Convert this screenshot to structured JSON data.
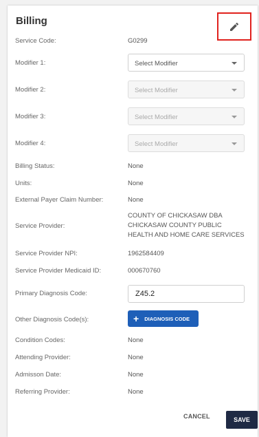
{
  "billing": {
    "title": "Billing",
    "service_code": {
      "label": "Service Code:",
      "value": "G0299"
    },
    "modifiers": [
      {
        "label": "Modifier 1:",
        "placeholder": "Select Modifier"
      },
      {
        "label": "Modifier 2:",
        "placeholder": "Select Modifier"
      },
      {
        "label": "Modifier 3:",
        "placeholder": "Select Modifier"
      },
      {
        "label": "Modifier 4:",
        "placeholder": "Select Modifier"
      }
    ],
    "billing_status": {
      "label": "Billing Status:",
      "value": "None"
    },
    "units": {
      "label": "Units:",
      "value": "None"
    },
    "external_payer_claim_number": {
      "label": "External Payer Claim Number:",
      "value": "None"
    },
    "service_provider": {
      "label": "Service Provider:",
      "lines": [
        "COUNTY OF CHICKASAW DBA",
        "CHICKASAW COUNTY PUBLIC",
        "HEALTH AND HOME CARE SERVICES"
      ]
    },
    "service_provider_npi": {
      "label": "Service Provider NPI:",
      "value": "1962584409"
    },
    "service_provider_medicaid_id": {
      "label": "Service Provider Medicaid ID:",
      "value": "000670760"
    },
    "primary_diagnosis_code": {
      "label": "Primary Diagnosis Code:",
      "value": "Z45.2"
    },
    "other_diagnosis_codes": {
      "label": "Other Diagnosis Code(s):",
      "button_label": "DIAGNOSIS CODE"
    },
    "condition_codes": {
      "label": "Condition Codes:",
      "value": "None"
    },
    "attending_provider": {
      "label": "Attending Provider:",
      "value": "None"
    },
    "admission_date": {
      "label": "Admisson Date:",
      "value": "None"
    },
    "referring_provider": {
      "label": "Referring Provider:",
      "value": "None"
    }
  },
  "actions": {
    "cancel_label": "CANCEL",
    "save_label": "SAVE"
  },
  "icons": {
    "edit": "pencil-icon",
    "add": "plus-icon",
    "dropdown": "caret-down-icon"
  },
  "colors": {
    "highlight_border": "#e0201c",
    "primary_button": "#1e5fb8",
    "save_button": "#1f2a44"
  }
}
